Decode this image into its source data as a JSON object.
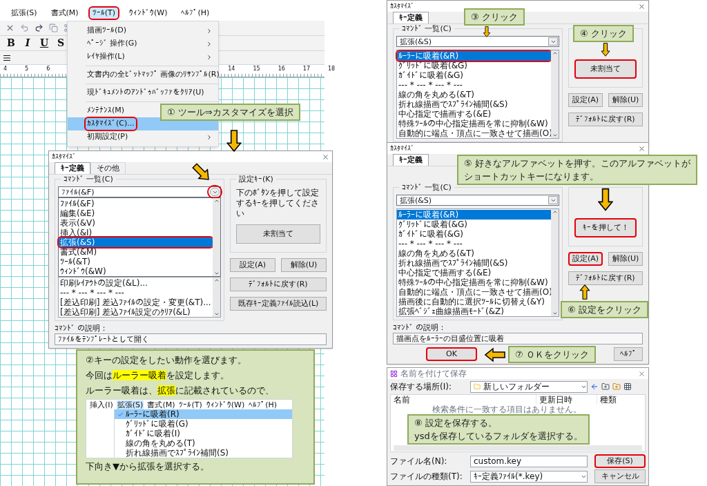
{
  "app_window": {
    "menu_bar": [
      {
        "label": "拡張(S)",
        "selected": false,
        "highlighted": false
      },
      {
        "label": "書式(M)",
        "selected": false,
        "highlighted": false
      },
      {
        "label": "ﾂｰﾙ(T)",
        "selected": true,
        "highlighted": true
      },
      {
        "label": "ｳｨﾝﾄﾞｳ(W)",
        "selected": false,
        "highlighted": false
      },
      {
        "label": "ﾍﾙﾌﾟ(H)",
        "selected": false,
        "highlighted": false
      }
    ],
    "format_buttons": [
      "B",
      "I",
      "U",
      "S"
    ],
    "ruler_numbers": [
      "4",
      "5",
      "6",
      "14",
      "15",
      "16",
      "17",
      "18"
    ],
    "tools_menu": [
      {
        "kind": "item",
        "label": "描画ﾂｰﾙ(D)",
        "submenu": true,
        "selected": false,
        "highlighted": false
      },
      {
        "kind": "item",
        "label": "ﾍﾟｰｼﾞ 操作(G)",
        "submenu": true,
        "selected": false,
        "highlighted": false
      },
      {
        "kind": "item",
        "label": "ﾚｲﾔ操作(L)",
        "submenu": true,
        "selected": false,
        "highlighted": false
      },
      {
        "kind": "separator"
      },
      {
        "kind": "item",
        "label": "文書内の全ﾋﾞｯﾄﾏｯﾌﾟ 画像のﾘｻﾝﾌﾟﾙ(R)",
        "selected": false,
        "highlighted": false
      },
      {
        "kind": "separator"
      },
      {
        "kind": "item",
        "label": "現ﾄﾞｷｭﾒﾝﾄのｱﾝﾄﾞｩﾊﾞｯﾌｧをｸﾘｱ(U)",
        "selected": false,
        "highlighted": false
      },
      {
        "kind": "separator"
      },
      {
        "kind": "item",
        "label": "ﾒﾝﾃﾅﾝｽ(M)",
        "selected": false,
        "highlighted": false
      },
      {
        "kind": "item",
        "label": "ｶｽﾀﾏｲｽﾞ(C)...",
        "selected": true,
        "highlighted": true
      },
      {
        "kind": "item",
        "label": "初期設定(P)",
        "submenu": true,
        "selected": false,
        "highlighted": false
      }
    ]
  },
  "dialog_1": {
    "title": "ｶｽﾀﾏｲｽﾞ",
    "tabs": [
      {
        "label": "ｷｰ定義",
        "selected": true
      },
      {
        "label": "その他",
        "selected": false
      }
    ],
    "command_group": "ｺﾏﾝﾄﾞ 一覧(C)",
    "combo": {
      "value": "ﾌｧｲﾙ(&F)",
      "highlighted": true
    },
    "dropdown": [
      {
        "label": "ﾌｧｲﾙ(&F)",
        "selected": false,
        "highlighted": false
      },
      {
        "label": "編集(&E)",
        "selected": false,
        "highlighted": false
      },
      {
        "label": "表示(&V)",
        "selected": false,
        "highlighted": false
      },
      {
        "label": "挿入(&I)",
        "selected": false,
        "highlighted": false
      },
      {
        "label": "拡張(&S)",
        "selected": true,
        "highlighted": true
      },
      {
        "label": "書式(&M)",
        "selected": false,
        "highlighted": false
      },
      {
        "label": "ﾂｰﾙ(&T)",
        "selected": false,
        "highlighted": false
      },
      {
        "label": "ｳｨﾝﾄﾞｳ(&W)",
        "selected": false,
        "highlighted": false
      }
    ],
    "commands": [
      {
        "label": "印刷ﾚｲｱｳﾄの設定(&L)...",
        "selected": false,
        "highlighted": false
      },
      {
        "label": "--- * --- * --- * ---",
        "selected": false,
        "highlighted": false
      },
      {
        "label": "[差込印刷] 差込ﾌｧｲﾙの設定・変更(&T)...",
        "selected": false,
        "highlighted": false
      },
      {
        "label": "[差込印刷] 差込ﾌｧｲﾙ設定のｸﾘｱ(&L)",
        "selected": false,
        "highlighted": false
      }
    ],
    "key_group": "設定ｷｰ(K)",
    "key_hint": "下のﾎﾞﾀﾝを押して設定するｷｰを押してください",
    "key_button": {
      "label": "未割当て",
      "highlighted": false
    },
    "buttons": [
      {
        "label": "設定(A)",
        "highlighted": false
      },
      {
        "label": "解除(U)",
        "highlighted": false
      },
      {
        "label": "ﾃﾞﾌｫﾙﾄに戻す(R)",
        "highlighted": false
      },
      {
        "label": "既存ｷｰ定義ﾌｧｲﾙ読込(L)",
        "highlighted": false
      }
    ],
    "description_label": "ｺﾏﾝﾄﾞ の説明：",
    "description": "ﾌｧｲﾙをﾃﾝﾌﾟﾚｰﾄとして開く"
  },
  "instruction_panel": {
    "lines": [
      [
        {
          "text": "②キーの設定をしたい動作を選びます。",
          "marked": false
        }
      ],
      [
        {
          "text": "今回は",
          "marked": false
        },
        {
          "text": "ルーラー吸着",
          "marked": true
        },
        {
          "text": "を設定します。",
          "marked": false
        }
      ],
      [
        {
          "text": "ルーラー吸着は、",
          "marked": false
        },
        {
          "text": "拡張",
          "marked": true
        },
        {
          "text": "に記載されているので、",
          "marked": false
        }
      ]
    ],
    "menu_bar": [
      {
        "label": "挿入(I)",
        "selected": false
      },
      {
        "label": "拡張(S)",
        "selected": true
      },
      {
        "label": "書式(M)",
        "selected": false
      },
      {
        "label": "ﾂｰﾙ(T)",
        "selected": false
      },
      {
        "label": "ｳｨﾝﾄﾞｳ(W)",
        "selected": false
      },
      {
        "label": "ﾍﾙﾌﾟ(H)",
        "selected": false
      }
    ],
    "menu_items": [
      {
        "label": "ﾙｰﾗｰに吸着(R)",
        "checked": true,
        "selected": true
      },
      {
        "label": "ｸﾞﾘｯﾄﾞに吸着(G)",
        "checked": false,
        "selected": false
      },
      {
        "label": "ｶﾞｲﾄﾞに吸着(I)",
        "checked": false,
        "selected": false
      },
      {
        "label": "線の角を丸める(T)",
        "checked": false,
        "selected": false
      },
      {
        "label": "折れ線描画でｽﾌﾟﾗｲﾝ補間(S)",
        "checked": false,
        "selected": false
      }
    ],
    "footer": "下向き▼から拡張を選択する。"
  },
  "dialog_2": {
    "title": "ｶｽﾀﾏｲｽﾞ",
    "tabs": [
      {
        "label": "ｷｰ定義",
        "selected": true
      }
    ],
    "command_group": "ｺﾏﾝﾄﾞ 一覧(C)",
    "combo": {
      "value": "拡張(&S)",
      "highlighted": false
    },
    "commands": [
      {
        "label": "ﾙｰﾗｰに吸着(&R)",
        "selected": true,
        "highlighted": true
      },
      {
        "label": "ｸﾞﾘｯﾄﾞに吸着(&G)",
        "selected": false,
        "highlighted": false
      },
      {
        "label": "ｶﾞｲﾄﾞに吸着(&G)",
        "selected": false,
        "highlighted": false
      },
      {
        "label": "--- * --- * --- * ---",
        "selected": false,
        "highlighted": false
      },
      {
        "label": "線の角を丸める(&T)",
        "selected": false,
        "highlighted": false
      },
      {
        "label": "折れ線描画でｽﾌﾟﾗｲﾝ補間(&S)",
        "selected": false,
        "highlighted": false
      },
      {
        "label": "中心指定で描画する(&E)",
        "selected": false,
        "highlighted": false
      },
      {
        "label": "特殊ﾂｰﾙの中心指定描画を常に抑制(&W)",
        "selected": false,
        "highlighted": false
      },
      {
        "label": "自動的に端点・頂点に一致させて描画(O)",
        "selected": false,
        "highlighted": false
      }
    ],
    "key_button": {
      "label": "未割当て",
      "highlighted": true
    },
    "buttons": [
      {
        "label": "設定(A)",
        "highlighted": false
      },
      {
        "label": "解除(U)",
        "highlighted": false
      },
      {
        "label": "ﾃﾞﾌｫﾙﾄに戻す(R)",
        "highlighted": false
      }
    ]
  },
  "dialog_3": {
    "title": "ｶｽﾀﾏｲｽﾞ",
    "tabs": [
      {
        "label": "ｷｰ定義",
        "selected": true
      }
    ],
    "command_group": "ｺﾏﾝﾄﾞ 一覧(C)",
    "combo": {
      "value": "拡張(&S)",
      "highlighted": false
    },
    "commands": [
      {
        "label": "ﾙｰﾗｰに吸着(&R)",
        "selected": true,
        "highlighted": false
      },
      {
        "label": "ｸﾞﾘｯﾄﾞに吸着(&G)",
        "selected": false,
        "highlighted": false
      },
      {
        "label": "ｶﾞｲﾄﾞに吸着(&G)",
        "selected": false,
        "highlighted": false
      },
      {
        "label": "--- * --- * --- * ---",
        "selected": false,
        "highlighted": false
      },
      {
        "label": "線の角を丸める(&T)",
        "selected": false,
        "highlighted": false
      },
      {
        "label": "折れ線描画でｽﾌﾟﾗｲﾝ補間(&S)",
        "selected": false,
        "highlighted": false
      },
      {
        "label": "中心指定で描画する(&E)",
        "selected": false,
        "highlighted": false
      },
      {
        "label": "特殊ﾂｰﾙの中心指定描画を常に抑制(&W)",
        "selected": false,
        "highlighted": false
      },
      {
        "label": "自動的に端点・頂点に一致させて描画(O)",
        "selected": false,
        "highlighted": false
      },
      {
        "label": "描画後に自動的に選択ﾂｰﾙに切替え(&Y)",
        "selected": false,
        "highlighted": false
      },
      {
        "label": "拡張ﾍﾞｼﾞｪ曲線描画ﾓｰﾄﾞ(&Z)",
        "selected": false,
        "highlighted": false
      }
    ],
    "key_button": {
      "label": "ｷｰを押して！",
      "highlighted": true
    },
    "buttons": [
      {
        "label": "設定(A)",
        "highlighted": true
      },
      {
        "label": "解除(U)",
        "highlighted": false
      },
      {
        "label": "ﾃﾞﾌｫﾙﾄに戻す(R)",
        "highlighted": false
      }
    ],
    "description_label": "ｺﾏﾝﾄﾞ の説明：",
    "description": "描画点をﾙｰﾗｰの目盛位置に吸着",
    "footer_buttons": [
      {
        "label": "OK",
        "highlighted": true
      },
      {
        "label": "ﾍﾙﾌﾟ",
        "highlighted": false
      }
    ]
  },
  "save_dialog": {
    "title": "名前を付けて保存",
    "location_label": "保存する場所(I):",
    "location": "新しいフォルダー",
    "columns": [
      "名前",
      "更新日時",
      "種類"
    ],
    "empty_message": "検索条件に一致する項目はありません。",
    "filename_label": "ファイル名(N):",
    "filename": "custom.key",
    "type_label": "ファイルの種類(T):",
    "type": "ｷｰ定義ﾌｧｲﾙ(*.key)",
    "buttons": [
      {
        "label": "保存(S)",
        "highlighted": true
      },
      {
        "label": "キャンセル",
        "highlighted": false
      }
    ]
  },
  "callouts": [
    {
      "lines": [
        "① ツール⇒カスタマイズを選択"
      ]
    },
    {
      "lines": [
        "③ クリック"
      ]
    },
    {
      "lines": [
        "④ クリック"
      ]
    },
    {
      "lines": [
        "⑤ 好きなアルファベットを押す。このアルファベットが",
        "ショートカットキーになります。"
      ]
    },
    {
      "lines": [
        "⑥ 設定をクリック"
      ]
    },
    {
      "lines": [
        "⑦ ＯＫをクリック"
      ]
    },
    {
      "lines": [
        "⑧ 設定を保存する。",
        "ysdを保存しているフォルダを選択する。"
      ]
    }
  ]
}
